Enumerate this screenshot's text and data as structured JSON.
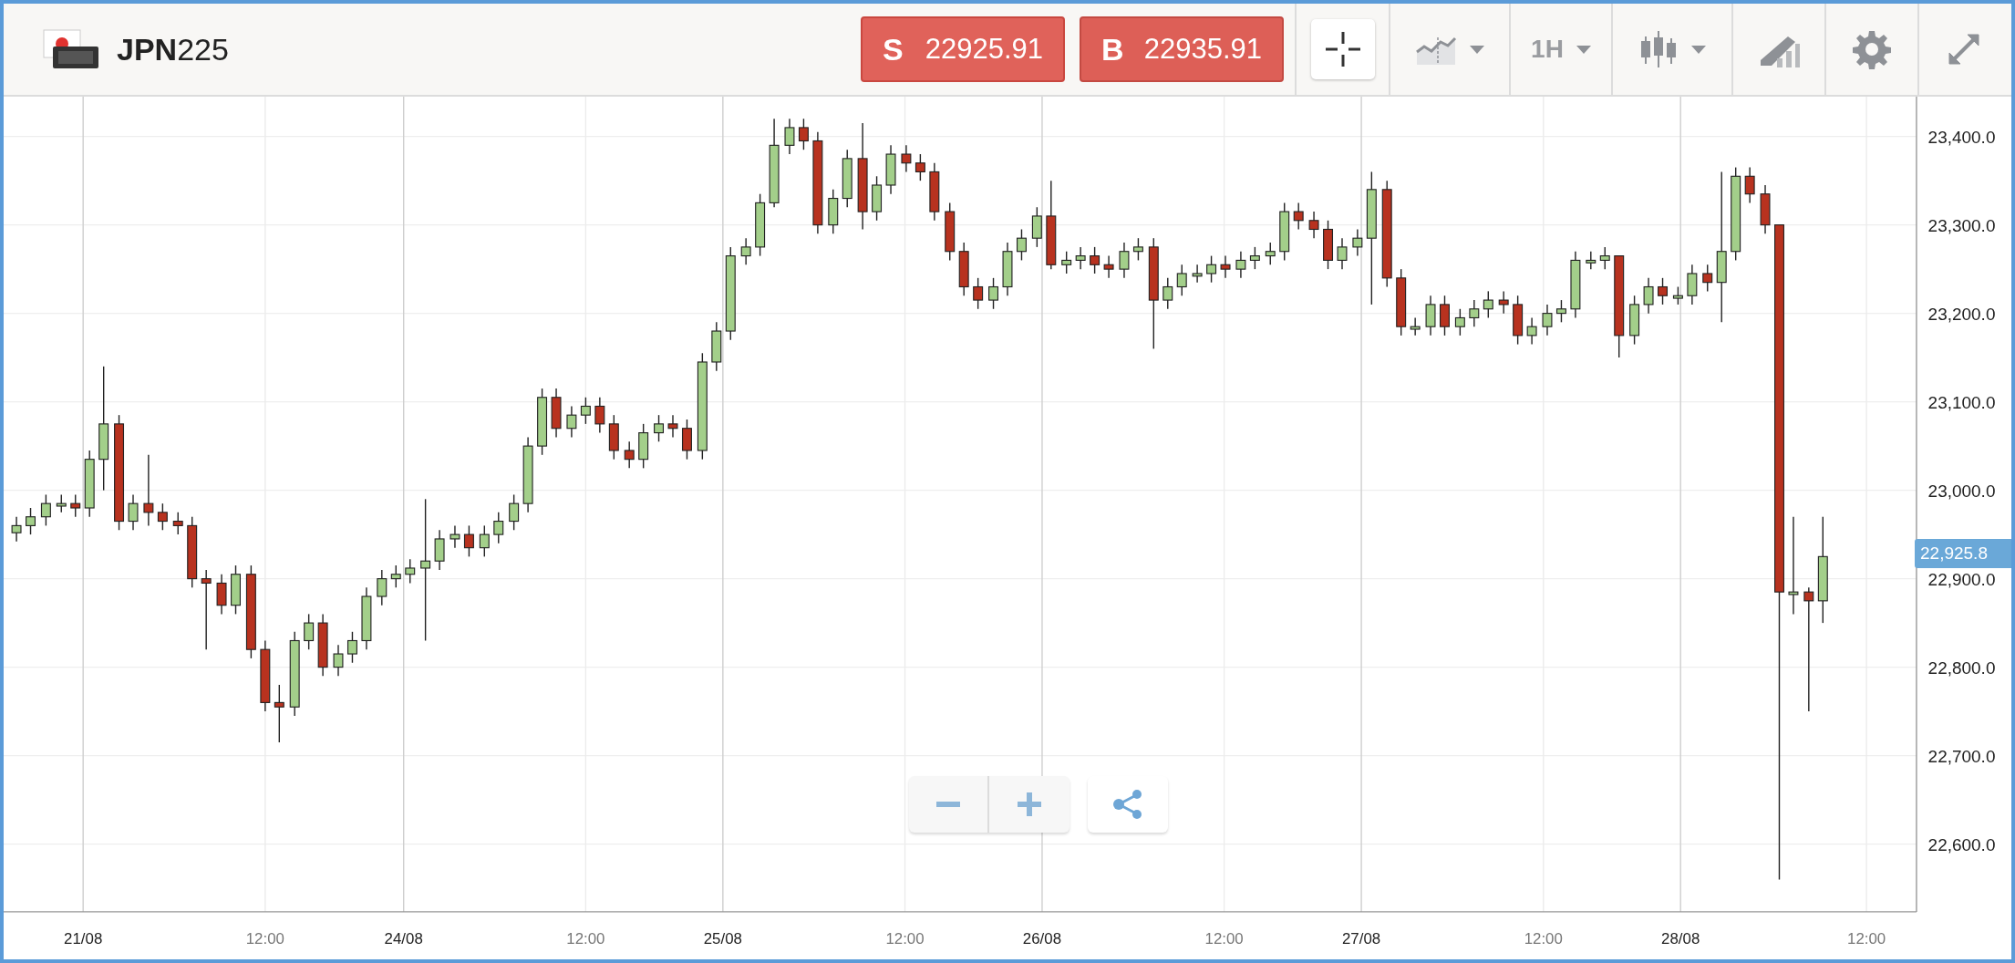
{
  "instrument": {
    "title": "**JPN**225"
  },
  "quotes": [
    {
      "kind": "sell",
      "letter": "S",
      "price": "22925.91"
    },
    {
      "kind": "buy",
      "letter": "B",
      "price": "22935.91"
    }
  ],
  "toolbar": [
    {
      "kind": "crosshair",
      "selected": true
    },
    {
      "kind": "chart-style",
      "selected": false
    },
    {
      "kind": "interval",
      "label": "1H",
      "selected": false
    },
    {
      "kind": "candles",
      "selected": false
    },
    {
      "kind": "draw",
      "selected": false
    },
    {
      "kind": "settings",
      "selected": false
    },
    {
      "kind": "fullscreen",
      "selected": false
    }
  ],
  "chart": {
    "y_ticks": [
      "23,400.0",
      "23,300.0",
      "23,200.0",
      "23,100.0",
      "23,000.0",
      "22,900.0",
      "22,800.0",
      "22,700.0",
      "22,600.0"
    ],
    "x_ticks": [
      {
        "kind": "day",
        "label": "21/08"
      },
      {
        "kind": "hour",
        "label": "12:00"
      },
      {
        "kind": "day",
        "label": "24/08"
      },
      {
        "kind": "hour",
        "label": "12:00"
      },
      {
        "kind": "day",
        "label": "25/08"
      },
      {
        "kind": "hour",
        "label": "12:00"
      },
      {
        "kind": "day",
        "label": "26/08"
      },
      {
        "kind": "hour",
        "label": "12:00"
      },
      {
        "kind": "day",
        "label": "27/08"
      },
      {
        "kind": "hour",
        "label": "12:00"
      },
      {
        "kind": "day",
        "label": "28/08"
      },
      {
        "kind": "hour",
        "label": "12:00"
      }
    ],
    "current_price": "22,925.8"
  }
}
